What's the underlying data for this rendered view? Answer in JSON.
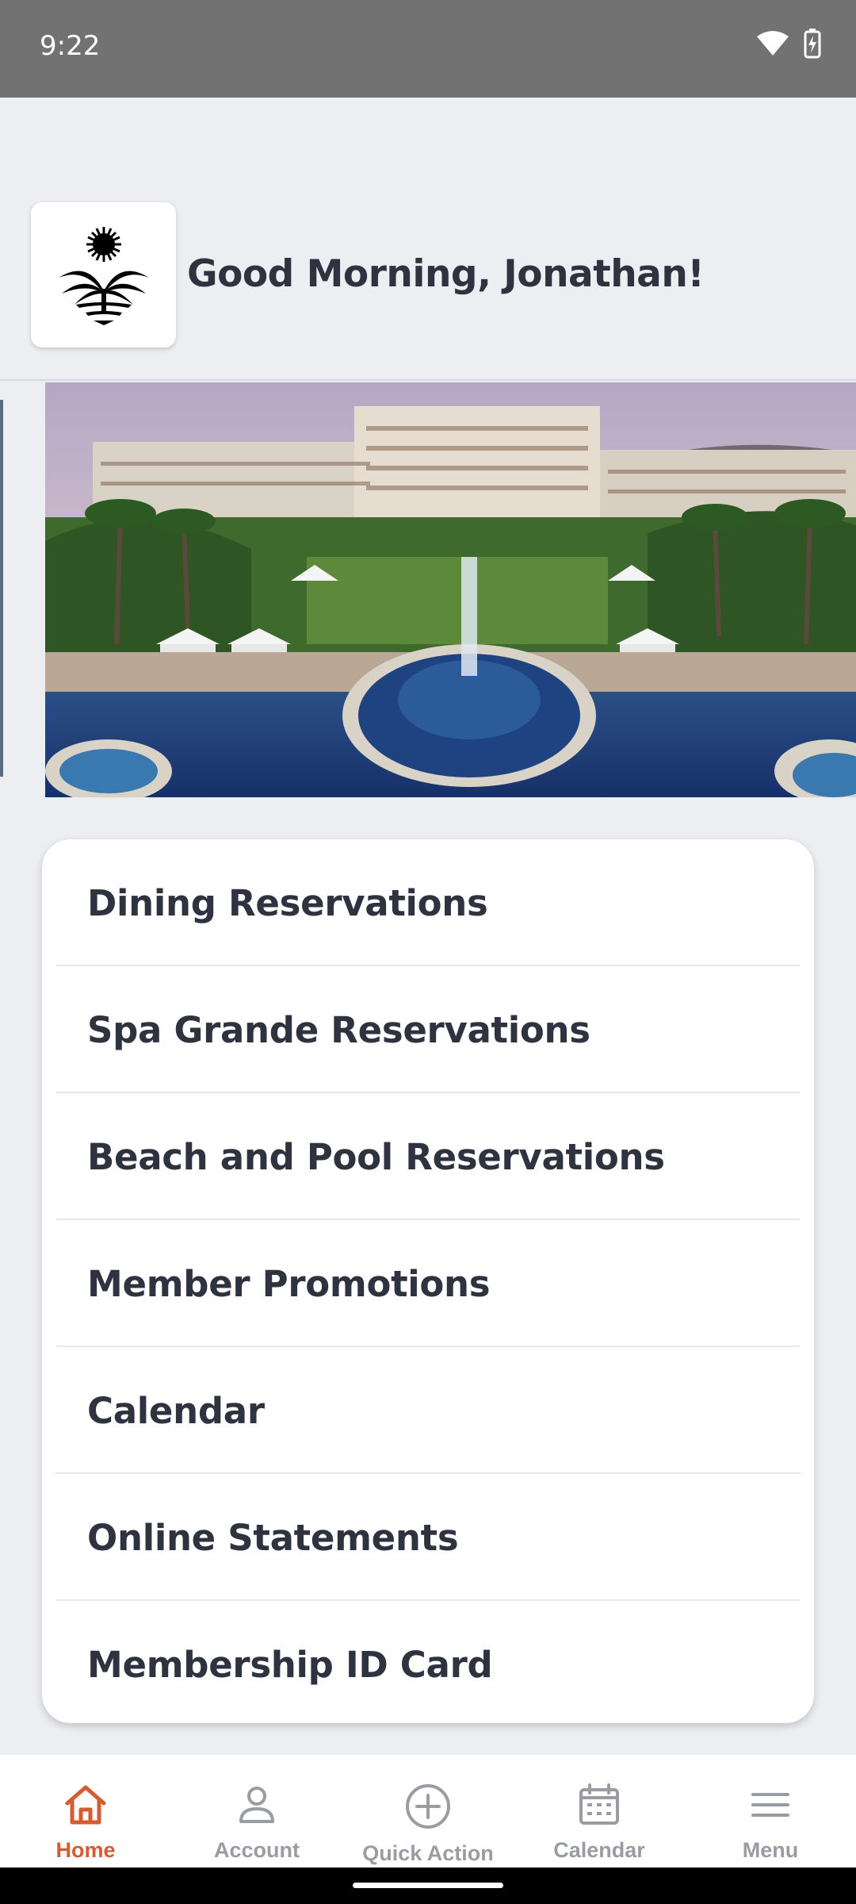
{
  "status_bar": {
    "time": "9:22",
    "icons": [
      "wifi-icon",
      "battery-charging-icon"
    ]
  },
  "header": {
    "logo_icon": "palm-tree-sun-logo",
    "greeting": "Good Morning, Jonathan!"
  },
  "carousel": {
    "image": "resort-pool-photo"
  },
  "menu": {
    "items": [
      {
        "label": "Dining Reservations"
      },
      {
        "label": "Spa Grande Reservations"
      },
      {
        "label": "Beach and Pool Reservations"
      },
      {
        "label": "Member Promotions"
      },
      {
        "label": "Calendar"
      },
      {
        "label": "Online Statements"
      },
      {
        "label": "Membership ID Card"
      }
    ]
  },
  "bottom_nav": {
    "active_color": "#d55b30",
    "inactive_color": "#9a9ca3",
    "items": [
      {
        "label": "Home",
        "icon": "home-icon",
        "active": true
      },
      {
        "label": "Account",
        "icon": "person-icon",
        "active": false
      },
      {
        "label": "Quick Action",
        "icon": "plus-circle-icon",
        "active": false
      },
      {
        "label": "Calendar",
        "icon": "calendar-icon",
        "active": false
      },
      {
        "label": "Menu",
        "icon": "hamburger-menu-icon",
        "active": false
      }
    ]
  }
}
